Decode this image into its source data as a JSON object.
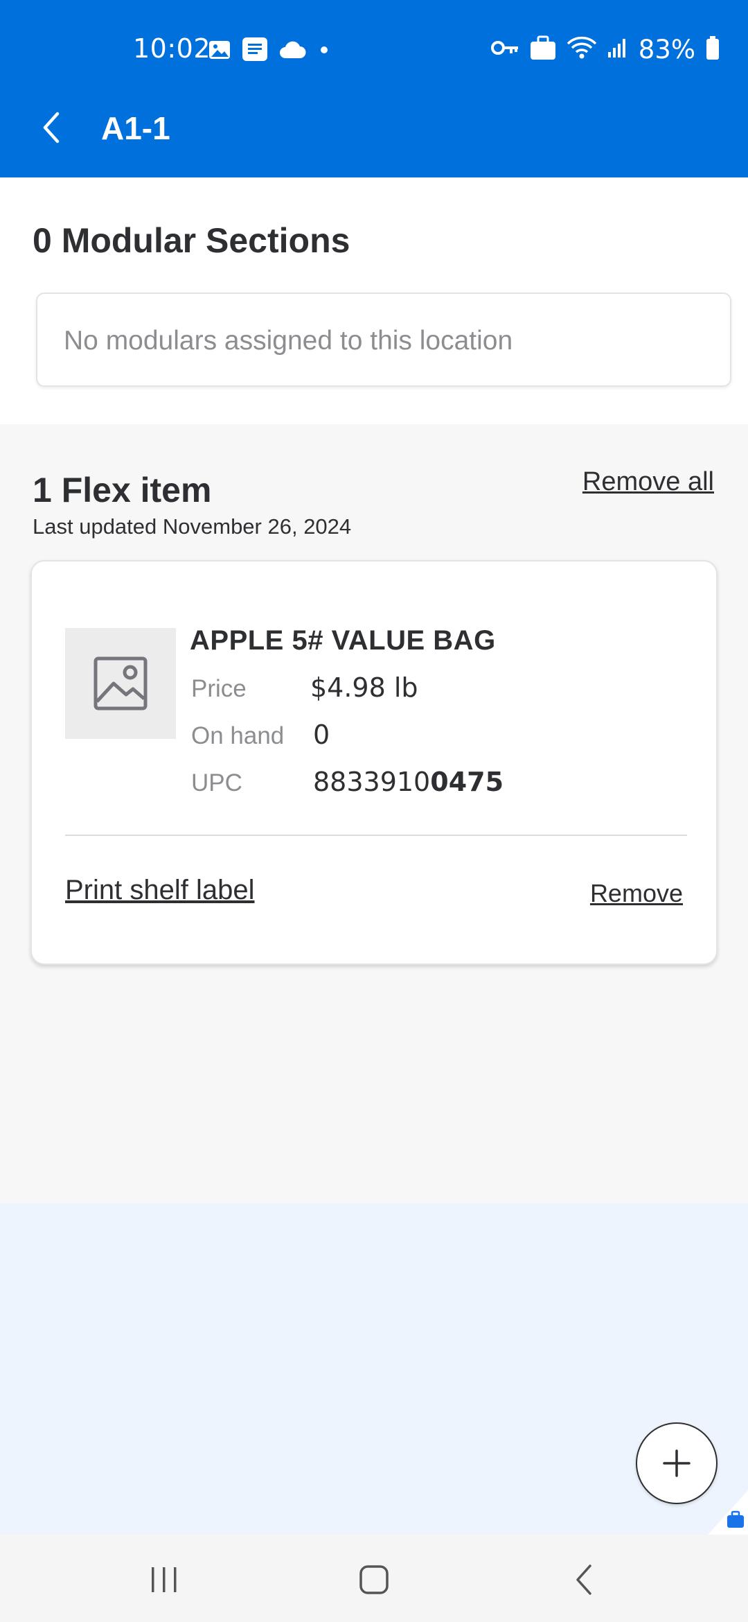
{
  "status_bar": {
    "time": "10:02",
    "battery": "83%",
    "left_icons": [
      "image-icon",
      "message-icon",
      "cloud-icon",
      "dot-icon"
    ],
    "right_icons": [
      "vpn-key-icon",
      "briefcase-icon",
      "wifi-icon",
      "signal-icon",
      "battery-icon"
    ]
  },
  "app_bar": {
    "back_icon": "chevron-left-icon",
    "title": "A1-1",
    "color": "#0071dc"
  },
  "modular": {
    "title": "0 Modular Sections",
    "empty_text": "No modulars assigned to this location"
  },
  "flex": {
    "title": "1 Flex item",
    "remove_all_label": "Remove all",
    "last_updated": "Last updated November 26, 2024",
    "items": [
      {
        "name": "APPLE 5# VALUE BAG",
        "price_label": "Price",
        "price_value": "$4.98 lb",
        "on_hand_label": "On hand",
        "on_hand_value": "0",
        "upc_label": "UPC",
        "upc_prefix": "8833910",
        "upc_suffix": "0475",
        "print_label": "Print shelf label",
        "remove_label": "Remove",
        "image_icon": "image-placeholder-icon"
      }
    ]
  },
  "fab": {
    "icon": "plus-icon"
  },
  "nav_bar": {
    "icons": [
      "recent-apps-icon",
      "home-icon",
      "back-icon"
    ]
  }
}
